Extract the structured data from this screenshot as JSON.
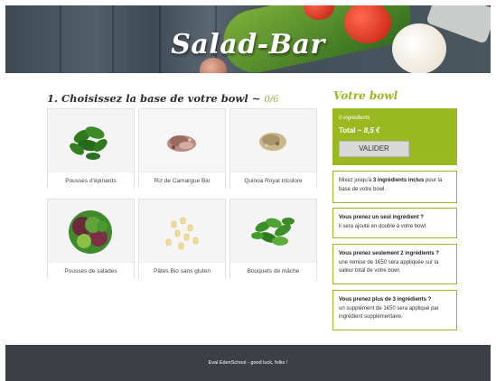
{
  "header": {
    "title": "Salad-Bar"
  },
  "section": {
    "title": "1. Choisissez la base de votre bowl ~ ",
    "count": "0/6"
  },
  "bases": [
    {
      "label": "Pousses d'épinards",
      "icon": "spinach-icon"
    },
    {
      "label": "Riz de Camargue Bio",
      "icon": "rice-icon"
    },
    {
      "label": "Quinoa Royal tricolore",
      "icon": "quinoa-icon"
    },
    {
      "label": "Pousses de salades",
      "icon": "salad-leaves-icon"
    },
    {
      "label": "Pâtes Bio sans gluten",
      "icon": "pasta-icon"
    },
    {
      "label": "Bouquets de mâche",
      "icon": "lambs-lettuce-icon"
    }
  ],
  "bowl": {
    "title": "Votre bowl",
    "ingredients": "0 ingrédients",
    "total_label": "Total ~ ",
    "total_value": "8,5 €",
    "validate_label": "VALIDER"
  },
  "info": {
    "box1_a": "Mixez jusqu'à ",
    "box1_b": "3 ingrédients inclus",
    "box1_c": " pour la base de votre bowl.",
    "box2_title": "Vous prenez un seul ingrédient ?",
    "box2_text": "il sera ajouté en double à votre bowl.",
    "box3_title": "Vous prenez seulement 2 ingrédients ?",
    "box3_text": "une remise de 1€50 sera appliquée sur la valeur total de votre bowl.",
    "box4_title": "Vous prenez plus de 3 ingrédients ?",
    "box4_text": "un supplément de 1€50 sera appliqué par ingrédient supplémentaire."
  },
  "footer": {
    "text": "Eval EdenSchool - good luck, folks !"
  },
  "colors": {
    "accent": "#9ab81f",
    "footer_bg": "#3c4046"
  }
}
